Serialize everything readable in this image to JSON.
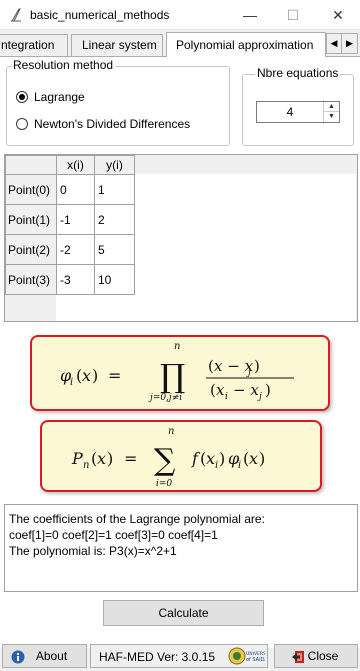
{
  "window": {
    "title": "basic_numerical_methods",
    "minimize_glyph": "—",
    "maximize_glyph": "☐",
    "close_glyph": "✕"
  },
  "tabs": [
    {
      "label": "ntegration"
    },
    {
      "label": "Linear system"
    },
    {
      "label": "Polynomial approximation",
      "active": true
    }
  ],
  "tab_scroll": {
    "left": "◀",
    "right": "▶"
  },
  "resolution": {
    "legend": "Resolution method",
    "options": [
      {
        "label": "Lagrange",
        "checked": true
      },
      {
        "label": "Newton's Divided Differences",
        "checked": false
      }
    ]
  },
  "equations": {
    "legend": "Nbre equations",
    "value": "4",
    "up": "▲",
    "down": "▼"
  },
  "grid": {
    "columns": [
      "x(i)",
      "y(i)"
    ],
    "rows": [
      {
        "label": "Point(0)",
        "x": "0",
        "y": "1"
      },
      {
        "label": "Point(1)",
        "x": "-1",
        "y": "2"
      },
      {
        "label": "Point(2)",
        "x": "-2",
        "y": "5"
      },
      {
        "label": "Point(3)",
        "x": "-3",
        "y": "10"
      }
    ]
  },
  "output": {
    "lines": [
      "The coefficients of the Lagrange polynomial are:",
      "coef[1]=0  coef[2]=1  coef[3]=0  coef[4]=1",
      "The polynomial is: P3(x)=x^2+1"
    ]
  },
  "buttons": {
    "calculate": "Calculate",
    "about": "About",
    "close": "Close"
  },
  "version": "HAF-MED Ver: 3.0.15",
  "colors": {
    "formula_bg": "#fdf8d4",
    "formula_border": "#d91a26",
    "about_icon": "#2a5fb0",
    "close_icon": "#c0261e"
  }
}
